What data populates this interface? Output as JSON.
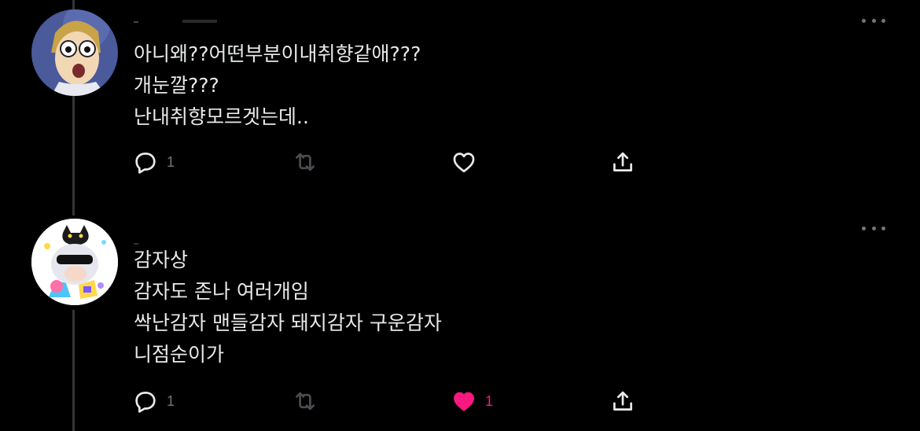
{
  "colors": {
    "background": "#000000",
    "text": "#e7e9ea",
    "muted": "#71767b",
    "like_active": "#f91880",
    "thread_line": "#333639"
  },
  "tweets": [
    {
      "lines": [
        "아니왜??어떤부분이내취향같애???",
        "개눈깔???",
        "난내취향모르겟는데.."
      ],
      "reply_count": "1",
      "like_count": "",
      "liked": false
    },
    {
      "lines": [
        "감자상",
        "감자도 존나 여러개임",
        "싹난감자 맨들감자 돼지감자 구운감자",
        "니점순이가"
      ],
      "reply_count": "1",
      "like_count": "1",
      "liked": true
    }
  ],
  "icons": {
    "reply": "reply-icon",
    "retweet": "retweet-icon",
    "like": "heart-icon",
    "share": "share-icon",
    "more": "more-icon"
  }
}
